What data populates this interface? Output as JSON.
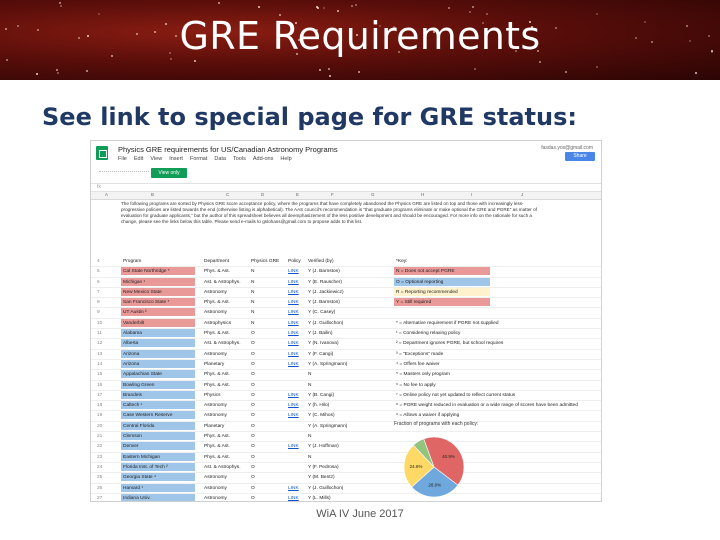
{
  "slide": {
    "title": "GRE Requirements",
    "subtitle": "See link to special page for GRE status:",
    "footer": "WiA IV June 2017"
  },
  "sheet": {
    "doc_title": "Physics GRE requirements for US/Canadian Astronomy Programs",
    "user": "fasdas.yos@gmail.com",
    "share_label": "Share",
    "view_only_label": "View only",
    "menu": [
      "File",
      "Edit",
      "View",
      "Insert",
      "Format",
      "Data",
      "Tools",
      "Add-ons",
      "Help"
    ],
    "fx_label": "fx",
    "col_letters": [
      "A",
      "B",
      "C",
      "D",
      "E",
      "F",
      "G",
      "H",
      "I",
      "J"
    ],
    "intro": "The following programs are sorted by Physics GRE score acceptance policy, where the programs that have completely abandoned the Physics GRE are listed on top and those with increasingly less-progressive policies are listed towards the end (otherwise listing is alphabetical). The AAS council's recommendation is \"that graduate programs eliminate or make optional the GRE and PGRE\" as matter of evaluation for graduate applicants,\" but the author of this spreadsheet believes all deemphasizement of the less positive development and should be encouraged. For more info on the rationale for such a change, please see the links below this table. Please send e-mails to gslohans@gmail.com to propose adds to this list.",
    "header": {
      "program": "Program",
      "dept": "Department",
      "gre": "Physics GRE",
      "policy": "Policy",
      "verified": "Verified (by)",
      "key": "*Key:"
    },
    "rows": [
      {
        "n": "5",
        "program": "Cal State Northridge *",
        "dept": "Phys. & Ast.",
        "gre": "N",
        "policy": "LINK",
        "verified": "Y (J. Barnston)",
        "color": "red",
        "key": "N = Does not accept PGRE",
        "keycolor": "red"
      },
      {
        "n": "6",
        "program": "Michigan ¹",
        "dept": "Ast. & Astrophys.",
        "gre": "N",
        "policy": "LINK",
        "verified": "Y (E. Rauscher)",
        "color": "red",
        "key": "O = Optional reporting",
        "keycolor": "blue"
      },
      {
        "n": "7",
        "program": "New Mexico State",
        "dept": "Astronomy",
        "gre": "N",
        "policy": "LINK",
        "verified": "Y (J. Jackiewicz)",
        "color": "red",
        "key": "R = Reporting recommended",
        "keycolor": "yellow"
      },
      {
        "n": "8",
        "program": "San Francisco State *",
        "dept": "Phys. & Ast.",
        "gre": "N",
        "policy": "LINK",
        "verified": "Y (J. Barnston)",
        "color": "red",
        "key": "Y = Still required",
        "keycolor": "red"
      },
      {
        "n": "9",
        "program": "UT Austin ²",
        "dept": "Astronomy",
        "gre": "N",
        "policy": "LINK",
        "verified": "Y (C. Casey)",
        "color": "red",
        "key": "",
        "keycolor": ""
      },
      {
        "n": "10",
        "program": "Vanderbilt",
        "dept": "Astrophysics",
        "gre": "N",
        "policy": "LINK",
        "verified": "Y (J. Guillochon)",
        "color": "red",
        "key": "* = Alternative requirement if PGRE not supplied",
        "keycolor": ""
      },
      {
        "n": "11",
        "program": "Alabama",
        "dept": "Phys. & Ast.",
        "gre": "O",
        "policy": "LINK",
        "verified": "Y (J. Bailin)",
        "color": "blue",
        "key": "¹ = Considering relaxing policy",
        "keycolor": ""
      },
      {
        "n": "12",
        "program": "Alberta",
        "dept": "Ast. & Astrophys.",
        "gre": "O",
        "policy": "LINK",
        "verified": "Y (N. Ivanova)",
        "color": "blue",
        "key": "² = Department ignores PGRE, but school requires",
        "keycolor": ""
      },
      {
        "n": "13",
        "program": "Arizona",
        "dept": "Astronomy",
        "gre": "O",
        "policy": "LINK",
        "verified": "Y (F. Cangi)",
        "color": "blue",
        "key": "³ = \"Exceptions\" made",
        "keycolor": ""
      },
      {
        "n": "14",
        "program": "Arizona",
        "dept": "Planetary",
        "gre": "O",
        "policy": "LINK",
        "verified": "Y (A. Springmann)",
        "color": "blue",
        "key": "⁴ = Offers fee waiver",
        "keycolor": ""
      },
      {
        "n": "15",
        "program": "Appalachian State",
        "dept": "Phys. & Ast.",
        "gre": "O",
        "policy": "",
        "verified": "N",
        "color": "blue",
        "key": "⁵ = Masters only program",
        "keycolor": ""
      },
      {
        "n": "16",
        "program": "Bowling Green",
        "dept": "Phys. & Ast.",
        "gre": "O",
        "policy": "",
        "verified": "N",
        "color": "blue",
        "key": "⁶ = No fee to apply",
        "keycolor": ""
      },
      {
        "n": "17",
        "program": "Brandeis",
        "dept": "Physics",
        "gre": "O",
        "policy": "LINK",
        "verified": "Y (B. Cangi)",
        "color": "blue",
        "key": "⁷ = Online policy not yet updated to reflect current status",
        "keycolor": ""
      },
      {
        "n": "18",
        "program": "Caltech ¹",
        "dept": "Astronomy",
        "gre": "O",
        "policy": "LINK",
        "verified": "Y (h. Hilo)",
        "color": "blue",
        "key": "⁸ = PGRE weight reduced in evaluation or a wide range of scores have been admitted",
        "keycolor": ""
      },
      {
        "n": "19",
        "program": "Case Western Reserve",
        "dept": "Astronomy",
        "gre": "O",
        "policy": "LINK",
        "verified": "Y (C. Mihos)",
        "color": "blue",
        "key": "⁹ = Allows a waiver if applying",
        "keycolor": ""
      },
      {
        "n": "20",
        "program": "Central Florida",
        "dept": "Planetary",
        "gre": "O",
        "policy": "",
        "verified": "Y (A. Springmann)",
        "color": "blue",
        "key": "",
        "keycolor": ""
      },
      {
        "n": "21",
        "program": "Clemson",
        "dept": "Phys. & Ast.",
        "gre": "O",
        "policy": "",
        "verified": "N",
        "color": "blue",
        "key": "",
        "keycolor": ""
      },
      {
        "n": "22",
        "program": "Denver",
        "dept": "Phys. & Ast.",
        "gre": "O",
        "policy": "LINK",
        "verified": "Y (J. Hoffman)",
        "color": "blue",
        "key": "",
        "keycolor": ""
      },
      {
        "n": "23",
        "program": "Eastern Michigan",
        "dept": "Phys. & Ast.",
        "gre": "O",
        "policy": "",
        "verified": "N",
        "color": "blue",
        "key": "",
        "keycolor": ""
      },
      {
        "n": "24",
        "program": "Florida Inst. of Tech ²",
        "dept": "Ast. & Astrophys.",
        "gre": "O",
        "policy": "",
        "verified": "Y (F. Pedrosa)",
        "color": "blue",
        "key": "",
        "keycolor": ""
      },
      {
        "n": "25",
        "program": "Georgia State ⁴",
        "dept": "Astronomy",
        "gre": "O",
        "policy": "",
        "verified": "Y (M. Bentz)",
        "color": "blue",
        "key": "",
        "keycolor": ""
      },
      {
        "n": "26",
        "program": "Harvard ¹",
        "dept": "Astronomy",
        "gre": "O",
        "policy": "LINK",
        "verified": "Y (J. Guillochon)",
        "color": "blue",
        "key": "",
        "keycolor": ""
      },
      {
        "n": "27",
        "program": "Indiana Univ.",
        "dept": "Astronomy",
        "gre": "O",
        "policy": "LINK",
        "verified": "Y (L. Mills)",
        "color": "blue",
        "key": "",
        "keycolor": ""
      },
      {
        "n": "28",
        "program": "Johns Hopkins",
        "dept": "Planetary",
        "gre": "O",
        "policy": "LINK",
        "verified": "Y (S. Hörst)",
        "color": "blue",
        "key": "",
        "keycolor": ""
      },
      {
        "n": "29",
        "program": "Kansas State",
        "dept": "Physics",
        "gre": "O",
        "policy": "LINK",
        "verified": "Y (J. Guillochon)",
        "color": "blue",
        "key": "",
        "keycolor": ""
      },
      {
        "n": "30",
        "program": "McGill",
        "dept": "Astrophysics",
        "gre": "O",
        "policy": "LINK",
        "verified": "Y (D. Haggard)",
        "color": "blue",
        "key": "",
        "keycolor": ""
      }
    ],
    "pie": {
      "title": "Fraction of programs with each policy:",
      "slices": [
        {
          "label": "40.9%",
          "value": 40.9,
          "color": "#e06666"
        },
        {
          "label": "28.0%",
          "value": 28.0,
          "color": "#6fa8dc"
        },
        {
          "label": "24.6%",
          "value": 24.6,
          "color": "#ffd966"
        },
        {
          "label": "6.5%",
          "value": 6.5,
          "color": "#93c47d"
        }
      ]
    }
  }
}
